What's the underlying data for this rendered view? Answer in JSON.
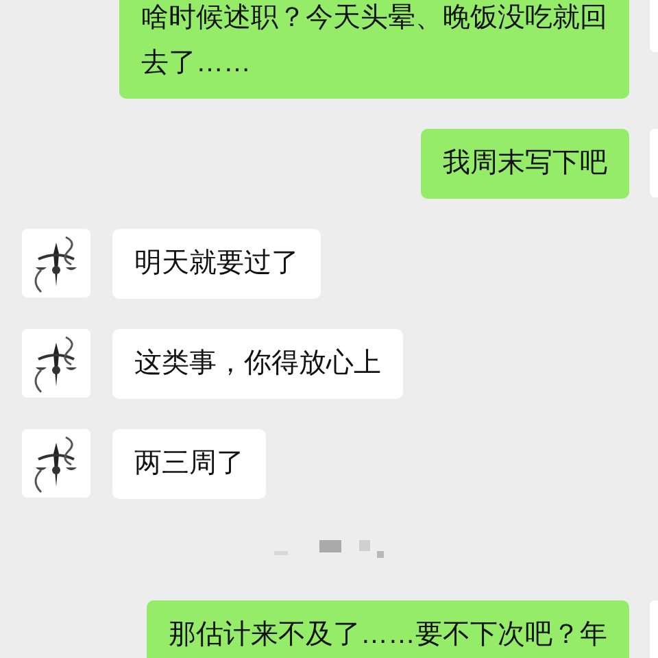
{
  "messages": [
    {
      "kind": "sent",
      "text": "啥时候述职？今天头晕、晚饭没吃就回去了……"
    },
    {
      "kind": "sent",
      "text": "我周末写下吧"
    },
    {
      "kind": "received",
      "text": "明天就要过了"
    },
    {
      "kind": "received",
      "text": "这类事，你得放心上"
    },
    {
      "kind": "received",
      "text": "两三周了"
    },
    {
      "kind": "blurred_time"
    },
    {
      "kind": "sent",
      "text": "那估计来不及了……要不下次吧？年"
    }
  ]
}
